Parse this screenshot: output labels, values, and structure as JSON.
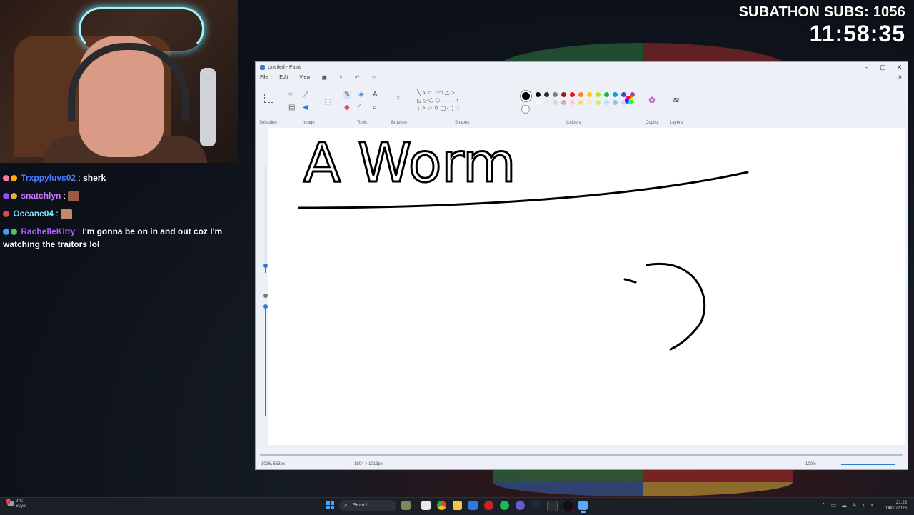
{
  "subathon": {
    "label": "SUBATHON SUBS: 1056",
    "timer": "11:58:35"
  },
  "chat": {
    "messages": [
      {
        "user": "Trxppyluvs02",
        "text": "sherk",
        "color": "#4a7dff"
      },
      {
        "user": "snatchlyn",
        "text": "",
        "color": "#c77dff"
      },
      {
        "user": "Oceane04",
        "text": "",
        "color": "#7fe3ff"
      },
      {
        "user": "RachelleKitty",
        "text": "I'm gonna be on in and out coz I'm watching the traitors lol",
        "color": "#b35cff"
      }
    ],
    "separator": ":"
  },
  "paint": {
    "title": "Untitled - Paint",
    "menu": {
      "file": "File",
      "edit": "Edit",
      "view": "View"
    },
    "ribbon": {
      "selection": "Selection",
      "image": "Image",
      "tools": "Tools",
      "brushes": "Brushes",
      "shapes": "Shapes",
      "colours": "Colours",
      "copilot": "Copilot",
      "layers": "Layers"
    },
    "palette_row1": [
      "#000000",
      "#2b2b2b",
      "#7f7f7f",
      "#a01a1a",
      "#e8141b",
      "#ff7f27",
      "#ffc90e",
      "#b5e61d",
      "#22b14c",
      "#00a2e8",
      "#3f48cc",
      "#a349a4"
    ],
    "palette_row2": [
      "#ffffff",
      "#e6e6e6",
      "#c3c3c3",
      "#b97a57",
      "#ffaec9",
      "#ffc90e",
      "#efe4b0",
      "#b5e61d",
      "#99d9ea",
      "#7092be",
      "#c8bfe7",
      "#d0d0d0"
    ],
    "canvas_text": "A Worm",
    "status": {
      "cursor": "1036, 553px",
      "canvas_size": "1804 × 1013px",
      "zoom": "100%"
    }
  },
  "taskbar": {
    "weather_temp": "9°C",
    "weather_desc": "Skyet",
    "weather_badge": "3",
    "search": "Search",
    "time": "21:23",
    "date": "14/01/2026"
  }
}
